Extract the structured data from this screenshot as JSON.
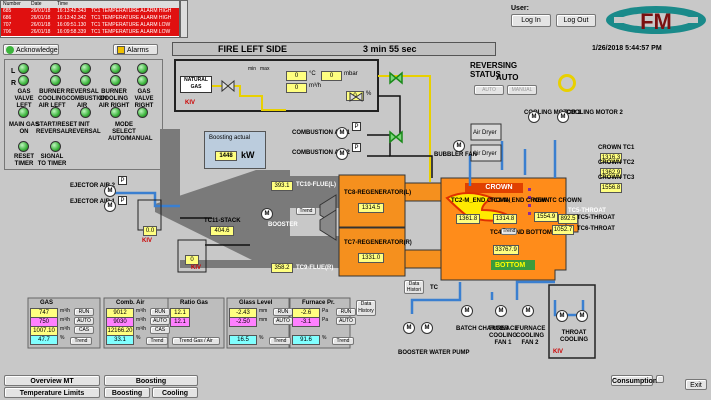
{
  "alarm_table": {
    "headers": [
      "Number",
      "Date",
      "Time",
      ""
    ],
    "rows": [
      [
        "685",
        "26/01/18",
        "16:13:42.343",
        "TC1 TEMPERATURE ALARM HIGH"
      ],
      [
        "686",
        "26/01/18",
        "16:13:42.342",
        "TC1 TEMPERATURE ALARM HIGH"
      ],
      [
        "707",
        "26/01/18",
        "16:09:51.130",
        "TC1 TEMPERATURE ALARM LOW"
      ],
      [
        "706",
        "26/01/18",
        "16:09:58.339",
        "TC1 TEMPERATURE ALARM LOW"
      ]
    ]
  },
  "login": {
    "user_label": "User:",
    "login": "Log In",
    "logout": "Log Out"
  },
  "toolbar": {
    "acknowledge": "Acknowledge",
    "alarms": "Alarms",
    "title": "FIRE LEFT SIDE",
    "timer": "3   min  55  sec",
    "datetime": "1/26/2018  5:44:57 PM"
  },
  "status_panel": {
    "leds": [
      "L",
      "R"
    ],
    "items": [
      {
        "label": "GAS VALVE LEFT"
      },
      {
        "label": "BURNER COOLING AIR LEFT"
      },
      {
        "label": "REVERSAL COMBUSTION AIR"
      },
      {
        "label": "BURNER COOLING AIR RIGHT"
      },
      {
        "label": "GAS VALVE RIGHT"
      },
      {
        "label": "MAIN GAS ON"
      },
      {
        "label": "START/RESET REVERSAL"
      },
      {
        "label": "INIT REVERSAL"
      },
      {
        "label": "MODE SELECT AUTO/MANUAL"
      },
      {
        "label": "RESET TIMER"
      },
      {
        "label": "SIGNAL TO TIMER"
      }
    ]
  },
  "gas_line": {
    "natural_gas": "NATURAL GAS",
    "kiv": "KIV",
    "min": "min",
    "max": "max",
    "temp": "0",
    "temp_unit": "°C",
    "pressure": "0",
    "pressure_unit": "mbar",
    "flow": "0",
    "flow_unit": "m³/h",
    "percent": "0",
    "percent_unit": "%"
  },
  "reversing": {
    "title": "REVERSING STATUS",
    "mode": "AUTO",
    "auto": "AUTO",
    "manual": "MANUAL"
  },
  "boosting": {
    "title": "Boosting actual",
    "value": "1448",
    "unit": "kW"
  },
  "fans": {
    "combustion_air_1": "COMBUSTION AIR 1",
    "combustion_air_2": "COMBUSTION AIR 2",
    "ejector_air_2": "EJECTOR AIR 2",
    "ejector_air_1": "EJECTOR AIR 1",
    "bubbler_fan": "BUBBLER FAN",
    "air_dryer": "Air Dryer",
    "cooling_motor_1": "COOLING MOTOR 1",
    "cooling_motor_2": "COOLING MOTOR 2",
    "booster": "BOOSTER",
    "booster_pump": "BOOSTER WATER PUMP",
    "batch_charger": "BATCH CHARGER",
    "furnace_cooling_1": "FURNACE COOLING FAN 1",
    "furnace_cooling_2": "FURNACE COOLING FAN 2",
    "throat_cooling": "THROAT COOLING"
  },
  "flue": {
    "tc10": "TC10-FLUE(L)",
    "tc10_value": "393.1",
    "tc9": "TC9-FLUE(R)",
    "tc9_value": "358.2",
    "tc11": "TC11-STACK",
    "tc11_value": "404.6",
    "damper_value": "0.0",
    "kiv": "KIV",
    "kiv2": "KIV",
    "damper2": "0"
  },
  "regenerators": [
    {
      "name": "TC8-REGENERATOR(L)",
      "value": "1314.5"
    },
    {
      "name": "TC7-REGENERATOR(R)",
      "value": "1331.0"
    }
  ],
  "furnace": {
    "crown": "CROWN",
    "bottom": "BOTTOM",
    "tc2": "TC2-M_END CROWN",
    "tc2_value": "1361.8",
    "tc3": "TC3-M_END CROWN",
    "tc3_value": "1314.8",
    "new_tc": "NEW TC CROWN",
    "new_tc_value": "1554.9",
    "tc4": "TC4-M_END BOTTOM",
    "tc4_value": "33767.9",
    "trend": "Trend",
    "data_histori": "Data Histori",
    "tc": "TC"
  },
  "crown_tcs": [
    {
      "label": "CROWN TC1",
      "value": "1316.3"
    },
    {
      "label": "CROWN TC2",
      "value": "1362.9"
    },
    {
      "label": "CROWN TC3",
      "value": "1556.8"
    }
  ],
  "throat": {
    "tc5": "TC5-THROAT",
    "tc5_value": "892.5",
    "tc6": "TC6-THROAT",
    "tc6_value": "1052.7",
    "kiv": "KIV"
  },
  "bottom_panels": {
    "gas": {
      "title": "GAS",
      "r1": "747",
      "u1": "m³/h",
      "r2": "750",
      "u2": "m³/h",
      "r3": "1007.10",
      "u3": "m³/h",
      "r4": "47.7",
      "u4": "%",
      "run": "RUN",
      "auto": "AUTO",
      "cas": "CAS",
      "trend": "Trend"
    },
    "comb_air": {
      "title": "Comb. Air",
      "r1": "9012",
      "u1": "m³/h",
      "r2": "9030",
      "u2": "m³/h",
      "r3": "12166.20",
      "u3": "m³/h",
      "r4": "33.1",
      "u4": "%",
      "run": "RUN",
      "auto": "AUTO",
      "cas": "CAS",
      "trend": "Trend"
    },
    "ratio_gas": {
      "title": "Ratio Gas",
      "r1": "12.1",
      "r2": "12.1",
      "trend": "Trend Gas / Air"
    },
    "glass_level": {
      "title": "Glass Level",
      "r1": "-2.43",
      "u1": "mm",
      "r2": "-2.50",
      "u2": "mm",
      "r4": "16.5",
      "u4": "%",
      "run": "RUN",
      "auto": "AUTO",
      "trend": "Trend"
    },
    "furnace_pr": {
      "title": "Furnace Pr.",
      "r1": "-2.6",
      "u1": "Pa",
      "r2": "-3.1",
      "u2": "Pa",
      "r4": "91.6",
      "u4": "%",
      "run": "RUN",
      "auto": "AUTO",
      "trend": "Trend",
      "data_history": "Data History"
    }
  },
  "footer": {
    "overview": "Overview MT",
    "boosting": "Boosting",
    "temperature_limits": "Temperature Limits",
    "boosting_limits": "Boosting Limits",
    "cooling_limits": "Cooling Limits",
    "consumption": "Consumption",
    "exit": "Exit"
  },
  "colors": {
    "alarm_red": "#e01010",
    "furnace_orange": "#ff8c1a",
    "regen_orange": "#f5901e",
    "duct_gray": "#7a7a7a",
    "pipe_blue": "#3a7fd0",
    "pipe_yellow": "#e8d000",
    "value_yellow": "#ffff80",
    "logo_teal": "#1a8a8a"
  }
}
